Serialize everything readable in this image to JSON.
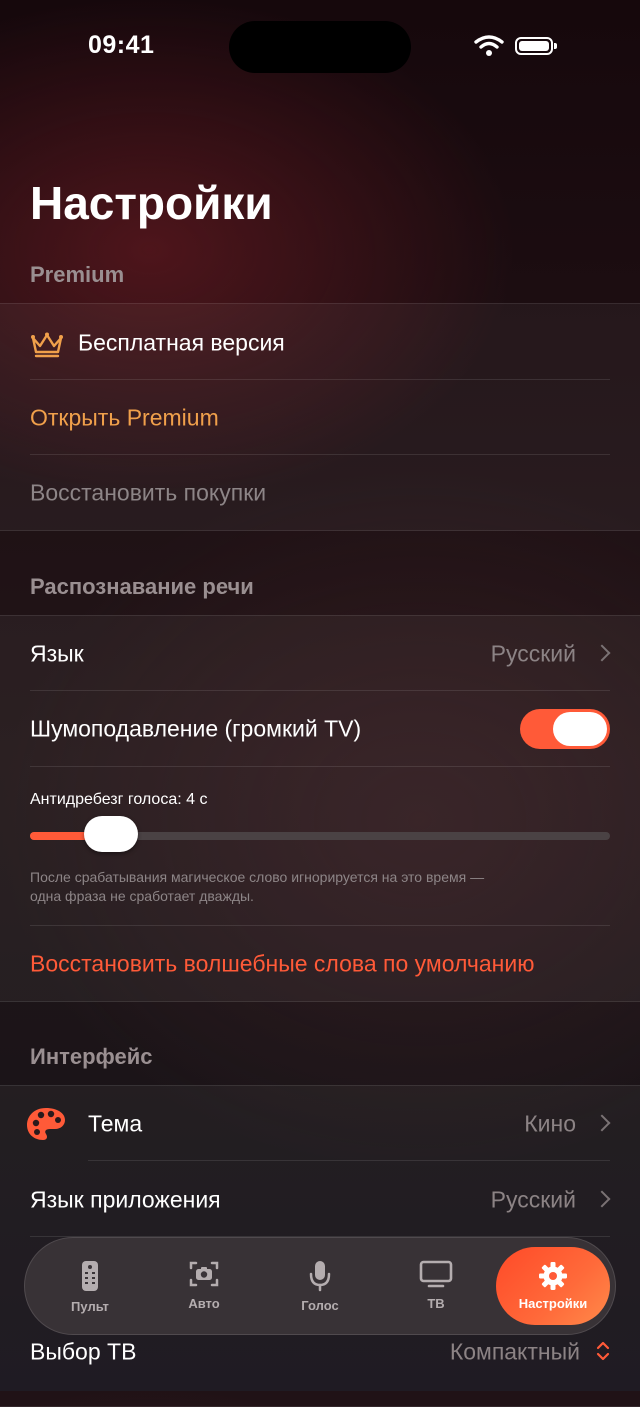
{
  "status_bar": {
    "time": "09:41",
    "battery_level": 1.0
  },
  "page_title": "Настройки",
  "premium": {
    "header": "Premium",
    "version_label": "Бесплатная версия",
    "open_premium": "Открыть Premium",
    "restore_purchases": "Восстановить покупки"
  },
  "speech": {
    "header": "Распознавание речи",
    "language_label": "Язык",
    "language_value": "Русский",
    "noise_label": "Шумоподавление (громкий TV)",
    "noise_enabled": true,
    "debounce_label": "Антидребезг голоса: 4 с",
    "debounce_value_fraction": 0.14,
    "debounce_hint": "После срабатывания магическое слово игнорируется на это время —",
    "debounce_hint2": "одна фраза не сработает дважды.",
    "reset_magic_words": "Восстановить волшебные слова по умолчанию"
  },
  "interface": {
    "header": "Интерфейс",
    "theme_label": "Тема",
    "theme_value": "Кино",
    "app_language_label": "Язык приложения",
    "app_language_value": "Русский",
    "tv_choice_label": "Выбор ТВ",
    "tv_choice_value": "Компактный"
  },
  "tabbar": {
    "items": [
      {
        "label": "Пульт",
        "icon": "remote-icon"
      },
      {
        "label": "Авто",
        "icon": "camera-scan-icon"
      },
      {
        "label": "Голос",
        "icon": "microphone-icon"
      },
      {
        "label": "ТВ",
        "icon": "tv-icon"
      },
      {
        "label": "Настройки",
        "icon": "gear-icon"
      }
    ],
    "active": "Настройки"
  },
  "colors": {
    "accent": "#ff5a38",
    "premium_orange": "#f0a04b",
    "muted_text": "#8d8587"
  }
}
